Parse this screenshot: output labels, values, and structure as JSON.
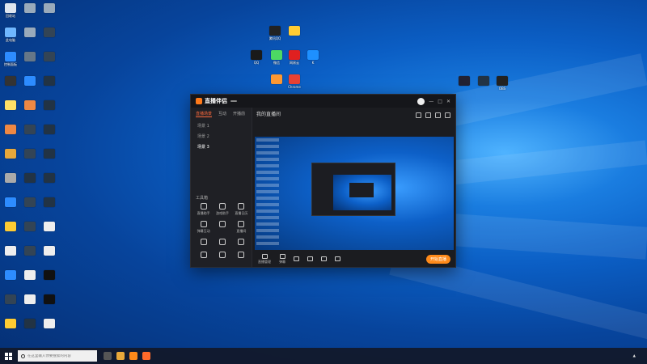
{
  "desktop": {
    "left_icons": [
      {
        "label": "回收站",
        "color": "#dfe6ef"
      },
      {
        "label": "",
        "color": "#9ab"
      },
      {
        "label": "",
        "color": "#9ab"
      },
      {
        "label": "此电脑",
        "color": "#6fb7ff"
      },
      {
        "label": "",
        "color": "#9ab"
      },
      {
        "label": "",
        "color": "#345"
      },
      {
        "label": "控制面板",
        "color": "#2d8cff"
      },
      {
        "label": "",
        "color": "#678"
      },
      {
        "label": "",
        "color": "#345"
      },
      {
        "label": "",
        "color": "#333"
      },
      {
        "label": "",
        "color": "#2d8cff"
      },
      {
        "label": "",
        "color": "#234"
      },
      {
        "label": "",
        "color": "#ffe066"
      },
      {
        "label": "",
        "color": "#e84"
      },
      {
        "label": "",
        "color": "#234"
      },
      {
        "label": "",
        "color": "#e84"
      },
      {
        "label": "",
        "color": "#345"
      },
      {
        "label": "",
        "color": "#234"
      },
      {
        "label": "",
        "color": "#e8a83a"
      },
      {
        "label": "",
        "color": "#345"
      },
      {
        "label": "",
        "color": "#234"
      },
      {
        "label": "",
        "color": "#aaa"
      },
      {
        "label": "",
        "color": "#234"
      },
      {
        "label": "",
        "color": "#234"
      },
      {
        "label": "",
        "color": "#2d8cff"
      },
      {
        "label": "",
        "color": "#345"
      },
      {
        "label": "",
        "color": "#234"
      },
      {
        "label": "",
        "color": "#ffcc33"
      },
      {
        "label": "",
        "color": "#345"
      },
      {
        "label": "",
        "color": "#eee"
      },
      {
        "label": "",
        "color": "#eee"
      },
      {
        "label": "",
        "color": "#345"
      },
      {
        "label": "",
        "color": "#eee"
      },
      {
        "label": "",
        "color": "#2d8cff"
      },
      {
        "label": "",
        "color": "#eee"
      },
      {
        "label": "",
        "color": "#111"
      },
      {
        "label": "",
        "color": "#345"
      },
      {
        "label": "",
        "color": "#eee"
      },
      {
        "label": "",
        "color": "#111"
      },
      {
        "label": "",
        "color": "#ffcc33"
      },
      {
        "label": "",
        "color": "#234"
      },
      {
        "label": "",
        "color": "#eee"
      }
    ],
    "center_icons": [
      {
        "label": "腾讯QQ",
        "color": "#222"
      },
      {
        "label": "",
        "color": "#ffcc33"
      },
      {
        "label": "QQ",
        "color": "#1a1a1a"
      },
      {
        "label": "微信",
        "color": "#4cd964"
      },
      {
        "label": "网易云",
        "color": "#e02020"
      },
      {
        "label": "K",
        "color": "#1e90ff"
      },
      {
        "label": "",
        "color": "#ff9933"
      },
      {
        "label": "Chrome",
        "color": "#e94235"
      }
    ],
    "right_icons": [
      {
        "label": "",
        "color": "#223"
      },
      {
        "label": "",
        "color": "#234"
      },
      {
        "label": "OBS",
        "color": "#222"
      }
    ]
  },
  "app": {
    "name": "直播伴侣",
    "badge": "",
    "controls": [
      "—",
      "□",
      "✕"
    ],
    "side_tabs": [
      "直播场景",
      "互动",
      "开播前"
    ],
    "scenes": [
      "场景 1",
      "场景 2",
      "场景 3"
    ],
    "tools_title": "工具箱",
    "tools": [
      "直播助手",
      "游戏助手",
      "直播日历",
      "弹幕互动",
      "",
      "直播间",
      "",
      "",
      "",
      "",
      "",
      ""
    ],
    "room_title": "我的直播间",
    "room_pill": "",
    "room_tags": [
      "",
      ""
    ],
    "room_meta": "",
    "controls_bar": [
      "直播管理",
      "弹幕",
      "",
      "",
      "",
      ""
    ],
    "live_button": "开始直播",
    "side_footer": "",
    "status": ""
  },
  "taskbar": {
    "search_placeholder": "在这里输入你要搜索的内容",
    "tray_text": "",
    "time": "",
    "date": ""
  }
}
